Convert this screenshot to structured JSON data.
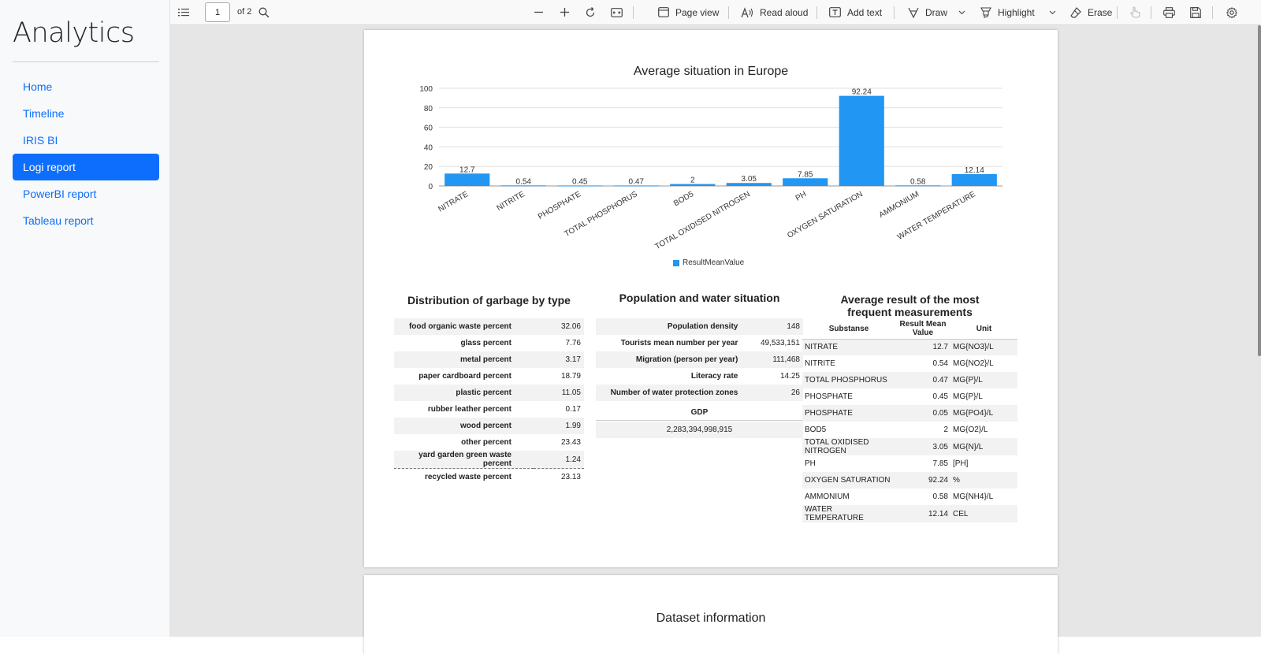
{
  "sidebar": {
    "brand": "Analytics",
    "items": [
      {
        "label": "Home"
      },
      {
        "label": "Timeline"
      },
      {
        "label": "IRIS BI"
      },
      {
        "label": "Logi report"
      },
      {
        "label": "PowerBI report"
      },
      {
        "label": "Tableau report"
      }
    ],
    "active_index": 3,
    "accent_color": "#0d6efd"
  },
  "toolbar": {
    "page_number": "1",
    "page_of": "of 2",
    "page_view": "Page view",
    "read_aloud": "Read aloud",
    "add_text": "Add text",
    "draw": "Draw",
    "highlight": "Highlight",
    "erase": "Erase"
  },
  "chart_data": {
    "type": "bar",
    "title": "Average situation in Europe",
    "categories": [
      "NITRATE",
      "NITRITE",
      "PHOSPHATE",
      "TOTAL PHOSPHORUS",
      "BOD5",
      "TOTAL OXIDISED NITROGEN",
      "PH",
      "OXYGEN SATURATION",
      "AMMONIUM",
      "WATER TEMPERATURE"
    ],
    "series": [
      {
        "name": "ResultMeanValue",
        "values": [
          12.7,
          0.54,
          0.45,
          0.47,
          2,
          3.05,
          7.85,
          92.24,
          0.58,
          12.14
        ],
        "color": "#2196f3"
      }
    ],
    "ylim": [
      0,
      100
    ],
    "yticks": [
      0,
      20,
      40,
      60,
      80,
      100
    ],
    "grid": true,
    "legend": "bottom"
  },
  "garbage": {
    "title": "Distribution of garbage by type",
    "rows": [
      {
        "label": "food organic waste percent",
        "value": "32.06"
      },
      {
        "label": "glass percent",
        "value": "7.76"
      },
      {
        "label": "metal percent",
        "value": "3.17"
      },
      {
        "label": "paper cardboard percent",
        "value": "18.79"
      },
      {
        "label": "plastic percent",
        "value": "11.05"
      },
      {
        "label": "rubber leather percent",
        "value": "0.17"
      },
      {
        "label": "wood percent",
        "value": "1.99"
      },
      {
        "label": "other percent",
        "value": "23.43"
      },
      {
        "label": "yard garden green waste percent",
        "value": "1.24"
      },
      {
        "label": "recycled waste percent",
        "value": "23.13"
      }
    ]
  },
  "population": {
    "title": "Population and water situation",
    "rows": [
      {
        "label": "Population density",
        "value": "148"
      },
      {
        "label": "Tourists mean number per year",
        "value": "49,533,151"
      },
      {
        "label": "Migration (person per year)",
        "value": "111,468"
      },
      {
        "label": "Literacy rate",
        "value": "14.25"
      },
      {
        "label": "Number of water protection zones",
        "value": "26"
      }
    ],
    "gdp_label": "GDP",
    "gdp_value": "2,283,394,998,915"
  },
  "measurements": {
    "title_line1": "Average result of the most",
    "title_line2": "frequent measurements",
    "headers": {
      "substance": "Substanse",
      "value_line1": "Result Mean",
      "value_line2": "Value",
      "unit": "Unit"
    },
    "rows": [
      {
        "substance": "NITRATE",
        "value": "12.7",
        "unit": "MG{NO3}/L"
      },
      {
        "substance": "NITRITE",
        "value": "0.54",
        "unit": "MG{NO2}/L"
      },
      {
        "substance": "TOTAL PHOSPHORUS",
        "value": "0.47",
        "unit": "MG{P}/L"
      },
      {
        "substance": "PHOSPHATE",
        "value": "0.45",
        "unit": "MG{P}/L"
      },
      {
        "substance": "PHOSPHATE",
        "value": "0.05",
        "unit": "MG{PO4}/L"
      },
      {
        "substance": "BOD5",
        "value": "2",
        "unit": "MG{O2}/L"
      },
      {
        "substance": "TOTAL OXIDISED NITROGEN",
        "value": "3.05",
        "unit": "MG{N}/L"
      },
      {
        "substance": "PH",
        "value": "7.85",
        "unit": "[PH]"
      },
      {
        "substance": "OXYGEN SATURATION",
        "value": "92.24",
        "unit": "%"
      },
      {
        "substance": "AMMONIUM",
        "value": "0.58",
        "unit": "MG{NH4}/L"
      },
      {
        "substance": "WATER TEMPERATURE",
        "value": "12.14",
        "unit": "CEL"
      }
    ]
  },
  "page2": {
    "title": "Dataset information"
  }
}
